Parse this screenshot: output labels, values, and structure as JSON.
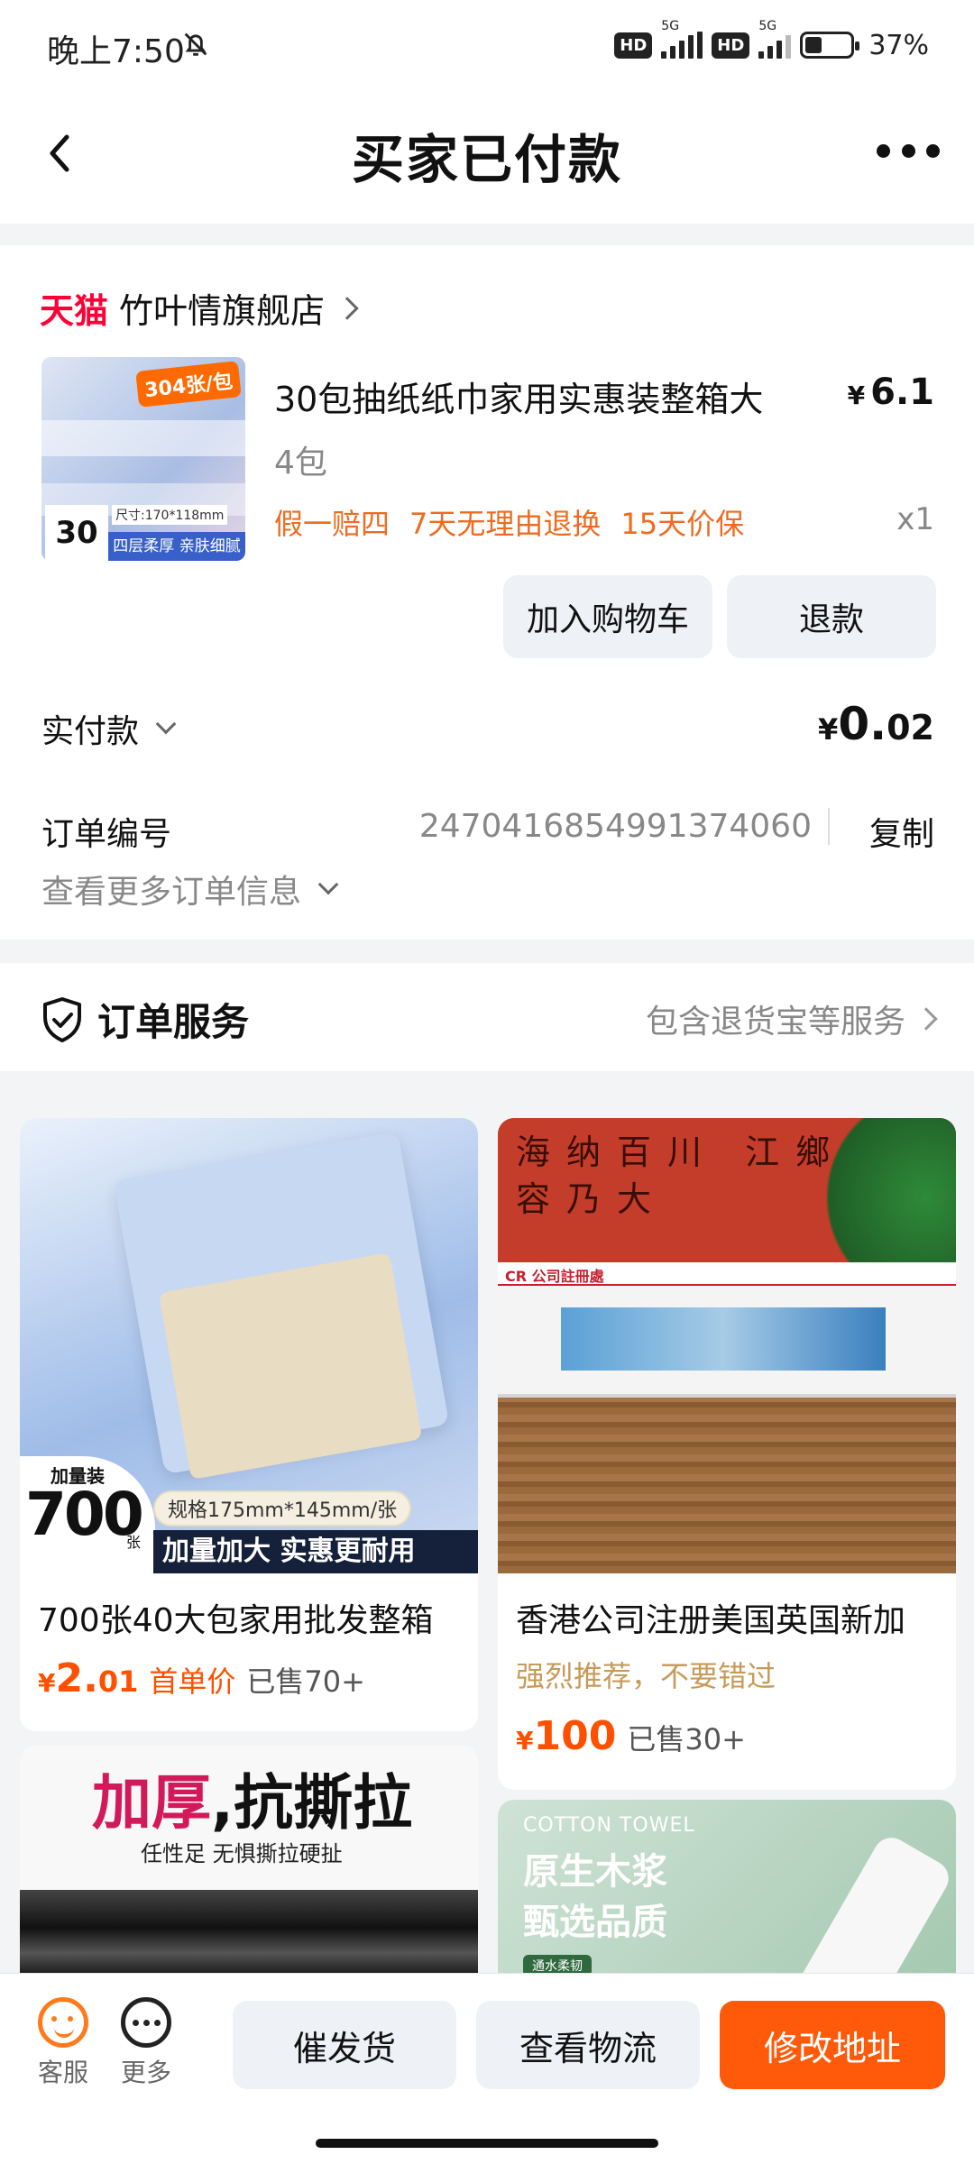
{
  "status_bar": {
    "time": "晚上7:50",
    "network1": "5G",
    "network2": "5G",
    "hd": "HD",
    "battery": "37%"
  },
  "nav": {
    "title": "买家已付款"
  },
  "order": {
    "platform_label": "天猫",
    "store_name": "竹叶情旗舰店",
    "thumb_tag": "304张/包",
    "thumb_count": "30包",
    "thumb_size": "尺寸:170*118mm",
    "thumb_band": "四层柔厚 亲肤细腻",
    "product_title": "30包抽纸纸巾家用实惠装整箱大",
    "price_currency": "¥",
    "price": "6.1",
    "spec": "4包",
    "tags": [
      "假一赔四",
      "7天无理由退换",
      "15天价保"
    ],
    "quantity": "x1",
    "add_to_cart": "加入购物车",
    "refund": "退款",
    "paid_label": "实付款",
    "paid_currency": "¥",
    "paid_int": "0.",
    "paid_dec": "02",
    "order_no_label": "订单编号",
    "order_no": "2470416854991374060",
    "copy": "复制",
    "more_info": "查看更多订单信息"
  },
  "service": {
    "title": "订单服务",
    "desc": "包含退货宝等服务"
  },
  "recommend": [
    {
      "title": "700张40大包家用批发整箱",
      "currency": "¥",
      "price_int": "2.",
      "price_dec": "01",
      "first": "首单价",
      "sold": "已售70+",
      "img_badge_label": "加量装",
      "img_badge_num": "700",
      "img_badge_unit": "张",
      "img_spec": "规格175mm*145mm/张",
      "img_banner": "加量加大 实惠更耐用"
    },
    {
      "title": "香港公司注册美国英国新加",
      "slogan": "强烈推荐，不要错过",
      "currency": "¥",
      "price": "100",
      "sold": "已售30+",
      "img_site": "CR 公司註冊處",
      "img_callig": "海纳百川 江鄉有 容乃大"
    },
    {
      "img_headline_pink": "加厚",
      "img_headline_rest": ",抗撕拉",
      "img_sub": "任性足 无惧撕拉硬扯"
    },
    {
      "img_en": "COTTON TOWEL",
      "img_line1": "原生木浆",
      "img_line2": "甄选品质",
      "img_tag": "通水柔韧"
    }
  ],
  "bottom_bar": {
    "service_label": "客服",
    "more_label": "更多",
    "urge": "催发货",
    "logistics": "查看物流",
    "change_address": "修改地址"
  },
  "colors": {
    "accent": "#ff5a0a",
    "tmall": "#ff0036",
    "tag_orange": "#ee6b1f",
    "price_orange": "#ff5000"
  }
}
